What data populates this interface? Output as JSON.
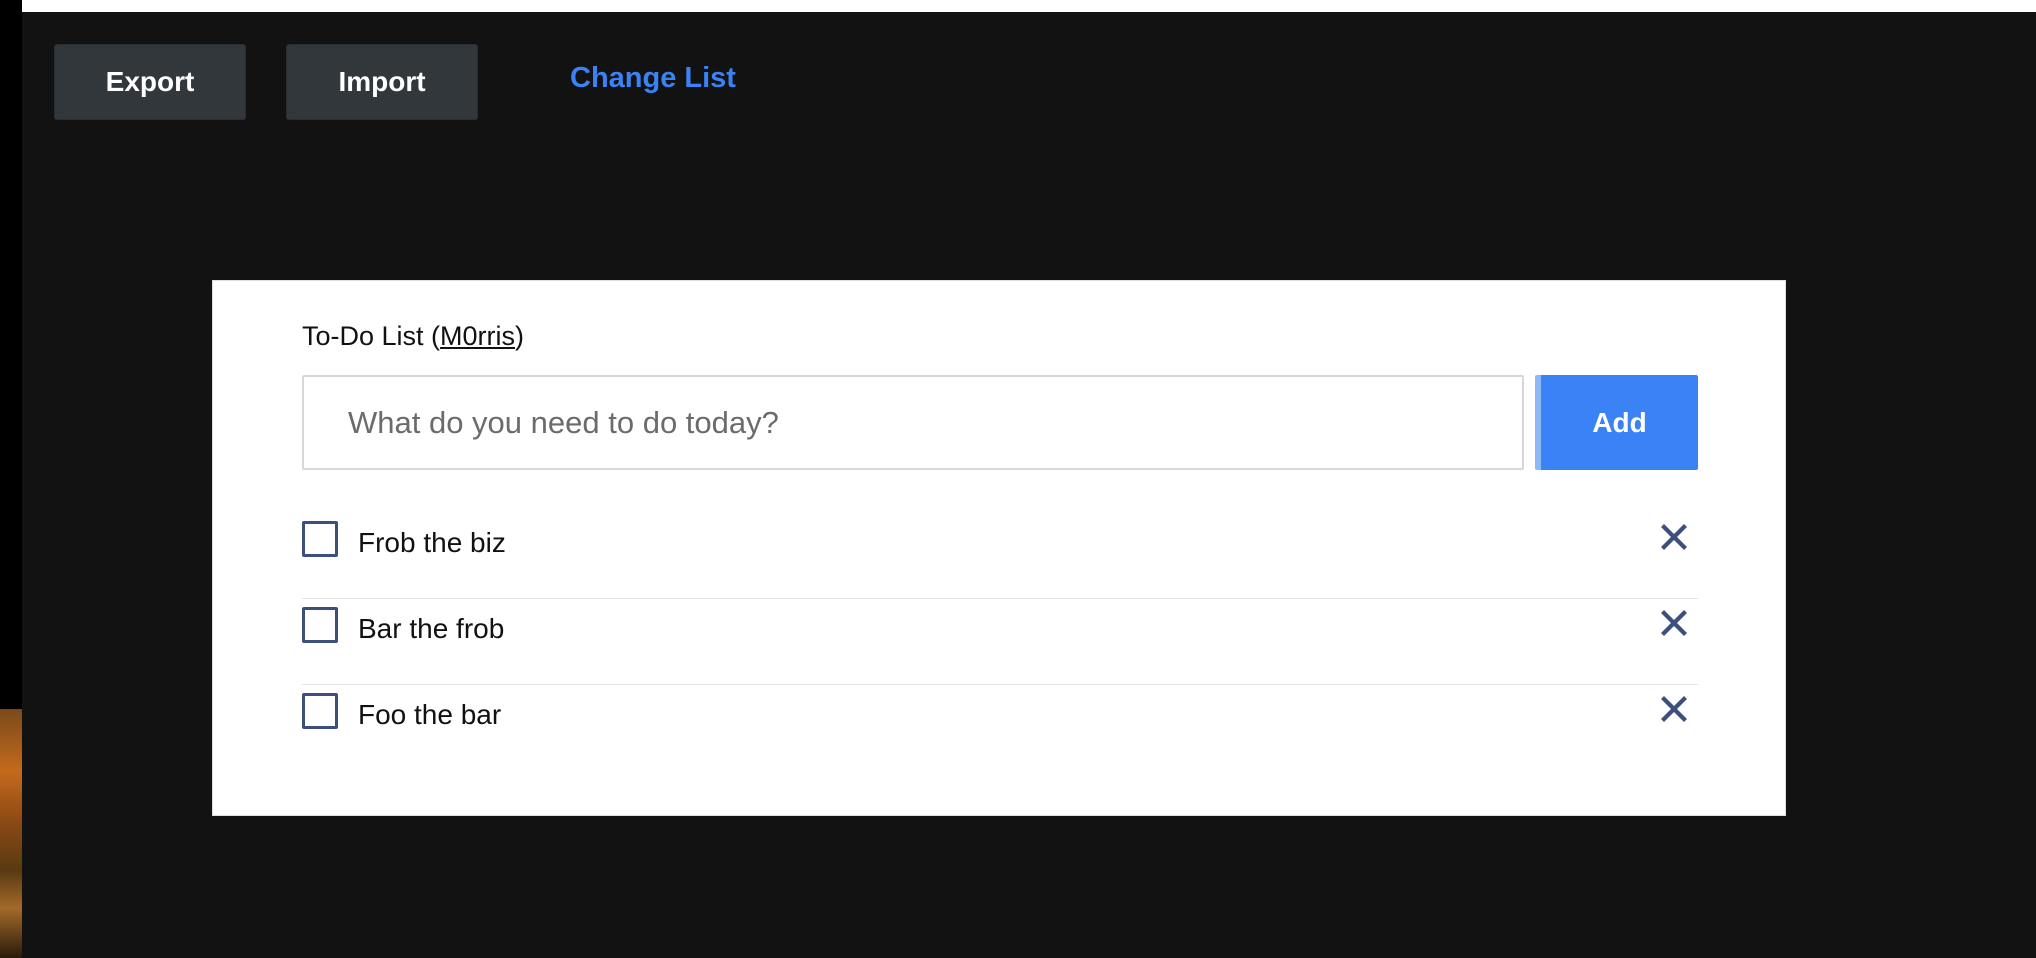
{
  "toolbar": {
    "export_label": "Export",
    "import_label": "Import",
    "change_list_label": "Change List"
  },
  "todo": {
    "title_prefix": "To-Do List (",
    "owner": "M0rris",
    "title_suffix": ")",
    "input_placeholder": "What do you need to do today?",
    "add_label": "Add",
    "items": [
      {
        "text": "Frob the biz",
        "done": false
      },
      {
        "text": "Bar the frob",
        "done": false
      },
      {
        "text": "Foo the bar",
        "done": false
      }
    ]
  },
  "colors": {
    "accent": "#3b82f6",
    "icon": "#3d4f7c",
    "background": "#121212"
  },
  "icons": {
    "delete": "x-mark-icon",
    "check": "checkbox-icon"
  }
}
